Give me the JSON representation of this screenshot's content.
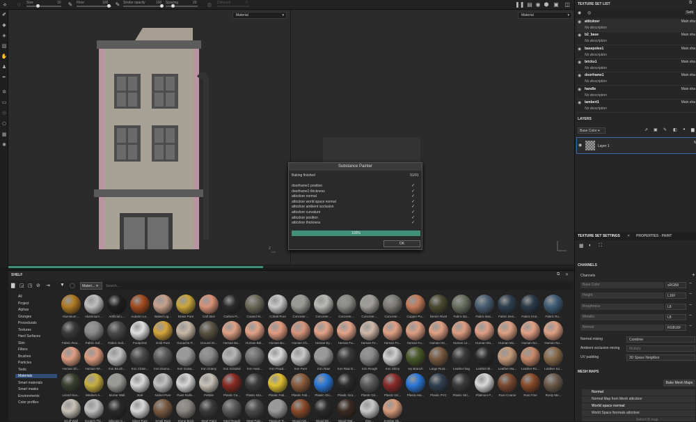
{
  "toolbar": {
    "size_label": "Size",
    "size_value": "10",
    "flow_label": "Flow",
    "flow_value": "100",
    "stroke_opacity_label": "Stroke opacity",
    "stroke_opacity_value": "100",
    "spacing_label": "Spacing",
    "spacing_value": "20",
    "distance_label": "Distance",
    "distance_value": "0"
  },
  "viewport": {
    "left_mode": "Material",
    "right_mode": "Material"
  },
  "progress": {
    "fraction": 0.45
  },
  "dialog": {
    "title": "Substance Painter",
    "status": "Baking finished",
    "count": "91/91",
    "items": [
      "doorframe1 position",
      "doorframe1 thickness",
      "atticdoor normal",
      "atticdoor world space normal",
      "atticdoor ambient occlusion",
      "atticdoor curvature",
      "atticdoor position",
      "atticdoor thickness"
    ],
    "progress_text": "100%",
    "ok_label": "OK"
  },
  "shelf": {
    "title": "SHELF",
    "filter_tag": "Materi...",
    "search_placeholder": "Search...",
    "categories": [
      "All",
      "Project",
      "Alphas",
      "Grunges",
      "Procedurals",
      "Textures",
      "Hard Surfaces",
      "Skin",
      "Filters",
      "Brushes",
      "Particles",
      "Tools",
      "Materials",
      "Smart materials",
      "Smart masks",
      "Environments",
      "Color profiles"
    ],
    "selected_category": "Materials",
    "materials": [
      {
        "name": "Aluminum ...",
        "color": "#b07a22"
      },
      {
        "name": "Aluminium ...",
        "color": "#bfbfbf"
      },
      {
        "name": "Artificial L...",
        "color": "#1e1e1e"
      },
      {
        "name": "Autumn Le...",
        "color": "#a24a1e"
      },
      {
        "name": "Baked Lig...",
        "color": "#c7a08a"
      },
      {
        "name": "Brass Pure",
        "color": "#c9a53a"
      },
      {
        "name": "Calf Skin",
        "color": "#d99277"
      },
      {
        "name": "Carbon Fi...",
        "color": "#2a2a2a"
      },
      {
        "name": "Coated M...",
        "color": "#6e6a5a"
      },
      {
        "name": "Cobalt Pure",
        "color": "#c8c8c8"
      },
      {
        "name": "Concrete ...",
        "color": "#9a9a94"
      },
      {
        "name": "Concrete ...",
        "color": "#b9b9b5"
      },
      {
        "name": "Concrete ...",
        "color": "#8a8a86"
      },
      {
        "name": "Concrete ...",
        "color": "#a09e98"
      },
      {
        "name": "Concrete ...",
        "color": "#7d7b74"
      },
      {
        "name": "Copper Pu...",
        "color": "#c47c5a"
      },
      {
        "name": "Denim Rivet",
        "color": "#4b4a30"
      },
      {
        "name": "Fabric Ba...",
        "color": "#6a7060"
      },
      {
        "name": "Fabric Bas...",
        "color": "#4a5f74"
      },
      {
        "name": "Fabric Den...",
        "color": "#2e4050"
      },
      {
        "name": "Fabric Knit...",
        "color": "#2b3a4a"
      },
      {
        "name": "Fabric Ro...",
        "color": "#3f5c77"
      },
      {
        "name": "Fabric Rou...",
        "color": "#3a3a3a"
      },
      {
        "name": "Fabric Sof...",
        "color": "#8a8a8a"
      },
      {
        "name": "Fabric Suit...",
        "color": "#4a4a4a"
      },
      {
        "name": "Footprints",
        "color": "#e0e0e0"
      },
      {
        "name": "Gold Pure",
        "color": "#d6a43a"
      },
      {
        "name": "Gouache P...",
        "color": "#c9b9a6"
      },
      {
        "name": "Ground Gr...",
        "color": "#5a5242"
      },
      {
        "name": "Human Ba...",
        "color": "#e0a085"
      },
      {
        "name": "Human Bel...",
        "color": "#e3a387"
      },
      {
        "name": "Human Bu...",
        "color": "#e29c80"
      },
      {
        "name": "Human Ch...",
        "color": "#d8967c"
      },
      {
        "name": "Human Ey...",
        "color": "#e3a286"
      },
      {
        "name": "Human Fa...",
        "color": "#e5a488"
      },
      {
        "name": "Human Fe...",
        "color": "#d0b8a8"
      },
      {
        "name": "Human Fo...",
        "color": "#e2a084"
      },
      {
        "name": "Human Fu...",
        "color": "#df9e82"
      },
      {
        "name": "Human He...",
        "color": "#e0a084"
      },
      {
        "name": "Human Le...",
        "color": "#dd9c80"
      },
      {
        "name": "Human Mo...",
        "color": "#e1a086"
      },
      {
        "name": "Human Mo...",
        "color": "#dea084"
      },
      {
        "name": "Human No...",
        "color": "#e3a185"
      },
      {
        "name": "Human No...",
        "color": "#e0a083"
      },
      {
        "name": "Human Sh...",
        "color": "#de9e82"
      },
      {
        "name": "Human Wr...",
        "color": "#dd9b7f"
      },
      {
        "name": "Iron Brush...",
        "color": "#c0c0c0"
      },
      {
        "name": "Iron Chain...",
        "color": "#4a4a4a"
      },
      {
        "name": "Iron Diamo...",
        "color": "#5a5a5a"
      },
      {
        "name": "Iron Galva...",
        "color": "#9a9a9a"
      },
      {
        "name": "Iron Grainy",
        "color": "#8a8a8a"
      },
      {
        "name": "Iron Grinded",
        "color": "#b5b5b5"
      },
      {
        "name": "Iron Ham...",
        "color": "#707070"
      },
      {
        "name": "Iron Powd...",
        "color": "#d8d8d8"
      },
      {
        "name": "Iron Pure",
        "color": "#c8c8c8"
      },
      {
        "name": "Iron Raw",
        "color": "#9a9a9a"
      },
      {
        "name": "Iron Raw D...",
        "color": "#3a3a3a"
      },
      {
        "name": "Iron Rough",
        "color": "#8a8a8a"
      },
      {
        "name": "Iron Shiny",
        "color": "#d0d0d0"
      },
      {
        "name": "Ivy Branch",
        "color": "#4a5a2a"
      },
      {
        "name": "Large Rust...",
        "color": "#7a5a40"
      },
      {
        "name": "Leather bag",
        "color": "#3a3a3a"
      },
      {
        "name": "Leather Bl...",
        "color": "#2a2a2a"
      },
      {
        "name": "Leather Ma...",
        "color": "#c49a7a"
      },
      {
        "name": "Leather Ro...",
        "color": "#c88a6a"
      },
      {
        "name": "Leather So...",
        "color": "#8a6a4a"
      },
      {
        "name": "Lizard Sca...",
        "color": "#3a4030"
      },
      {
        "name": "Medium A...",
        "color": "#c8b040"
      },
      {
        "name": "Mortar Wall",
        "color": "#9a9a96"
      },
      {
        "name": "Nail",
        "color": "#d8d8d8"
      },
      {
        "name": "Nickel Pure",
        "color": "#c0c0c0"
      },
      {
        "name": "Paint Rolle...",
        "color": "#d8d8d8"
      },
      {
        "name": "Pebble",
        "color": "#c8c2b8"
      },
      {
        "name": "Plastic Ca...",
        "color": "#8a2a22"
      },
      {
        "name": "Plastic Dia...",
        "color": "#3a3a3a"
      },
      {
        "name": "Plastic Fab...",
        "color": "#e0c030"
      },
      {
        "name": "Plastic Fab...",
        "color": "#8a5a3a"
      },
      {
        "name": "Plastic Glo...",
        "color": "#2a78d8"
      },
      {
        "name": "Plastic Gra...",
        "color": "#2a2a2a"
      },
      {
        "name": "Plastic Gri...",
        "color": "#5a5a5a"
      },
      {
        "name": "Plastic Gri...",
        "color": "#8a2a2a"
      },
      {
        "name": "Plastic Ma...",
        "color": "#2a78d8"
      },
      {
        "name": "Plastic PVC",
        "color": "#304050"
      },
      {
        "name": "Plastic Stri...",
        "color": "#3a3a3a"
      },
      {
        "name": "Platinum P...",
        "color": "#d8d8d8"
      },
      {
        "name": "Rust Coarse",
        "color": "#7a4a30"
      },
      {
        "name": "Rust Fine",
        "color": "#8a4a2a"
      },
      {
        "name": "Rusty Me...",
        "color": "#6a5a4a"
      },
      {
        "name": "Scuff Wall",
        "color": "#c8c2b8"
      },
      {
        "name": "Scratch Thi...",
        "color": "#c0c0c0"
      },
      {
        "name": "Silicone C...",
        "color": "#2a2a2a"
      },
      {
        "name": "Silver Pure",
        "color": "#d8d8d8"
      },
      {
        "name": "Small Rust",
        "color": "#7a5a40"
      },
      {
        "name": "Stone Brick",
        "color": "#8a8680"
      },
      {
        "name": "Steel Paint",
        "color": "#3a3a3a"
      },
      {
        "name": "Steel Rough",
        "color": "#5a5a5a"
      },
      {
        "name": "Steel Pain...",
        "color": "#4a4a4a"
      },
      {
        "name": "Titanium R...",
        "color": "#9a9a9a"
      },
      {
        "name": "Wood Alm...",
        "color": "#8a4a2a"
      },
      {
        "name": "Wood Bri...",
        "color": "#2a2a2a"
      },
      {
        "name": "Wood Wal...",
        "color": "#3a2a22"
      },
      {
        "name": "Zinc...",
        "color": "#c8c8c8"
      },
      {
        "name": "Zombie Sk...",
        "color": "#d89a7a"
      }
    ]
  },
  "texture_set_list": {
    "title": "TEXTURE SET LIST",
    "settings_label": "Setti",
    "items": [
      {
        "name": "atticdoor",
        "desc": "No description",
        "shader": "Main sha"
      },
      {
        "name": "b2_base",
        "desc": "No description",
        "shader": "Main sha"
      },
      {
        "name": "basepoles1",
        "desc": "No description",
        "shader": "Main sha"
      },
      {
        "name": "bricks1",
        "desc": "No description",
        "shader": "Main sha"
      },
      {
        "name": "doorframe1",
        "desc": "No description",
        "shader": "Main sha"
      },
      {
        "name": "handle",
        "desc": "No description",
        "shader": "Main sha"
      },
      {
        "name": "lambert1",
        "desc": "No description",
        "shader": "Main sha"
      }
    ]
  },
  "layers": {
    "title": "LAYERS",
    "channel_select": "Base Color",
    "layer_name": "Layer 1",
    "layer_blend": "N"
  },
  "tss": {
    "tab_active": "TEXTURE SET SETTINGS",
    "tab_other": "PROPERTIES - PAINT",
    "channels_title": "CHANNELS",
    "channels_label": "Channels",
    "channels": [
      {
        "name": "Base Color",
        "fmt": "sRGB8"
      },
      {
        "name": "Height",
        "fmt": "L16F"
      },
      {
        "name": "Roughness",
        "fmt": "L8"
      },
      {
        "name": "Metallic",
        "fmt": "L8"
      },
      {
        "name": "Normal",
        "fmt": "RGB16F"
      }
    ],
    "normal_mixing_label": "Normal mixing",
    "normal_mixing_value": "Combine",
    "ao_mixing_label": "Ambient occlusion mixing",
    "ao_mixing_value": "Multiply",
    "uv_padding_label": "UV padding",
    "uv_padding_value": "3D Space Neighbor",
    "mesh_maps_title": "MESH MAPS",
    "bake_button": "Bake Mesh Maps",
    "mesh_maps": [
      {
        "type": "Normal",
        "source": "Normal Map from Mesh atticdoor"
      },
      {
        "type": "World space normal",
        "source": "World Space Normals atticdoor"
      }
    ],
    "last_partial": "Select ID map"
  }
}
